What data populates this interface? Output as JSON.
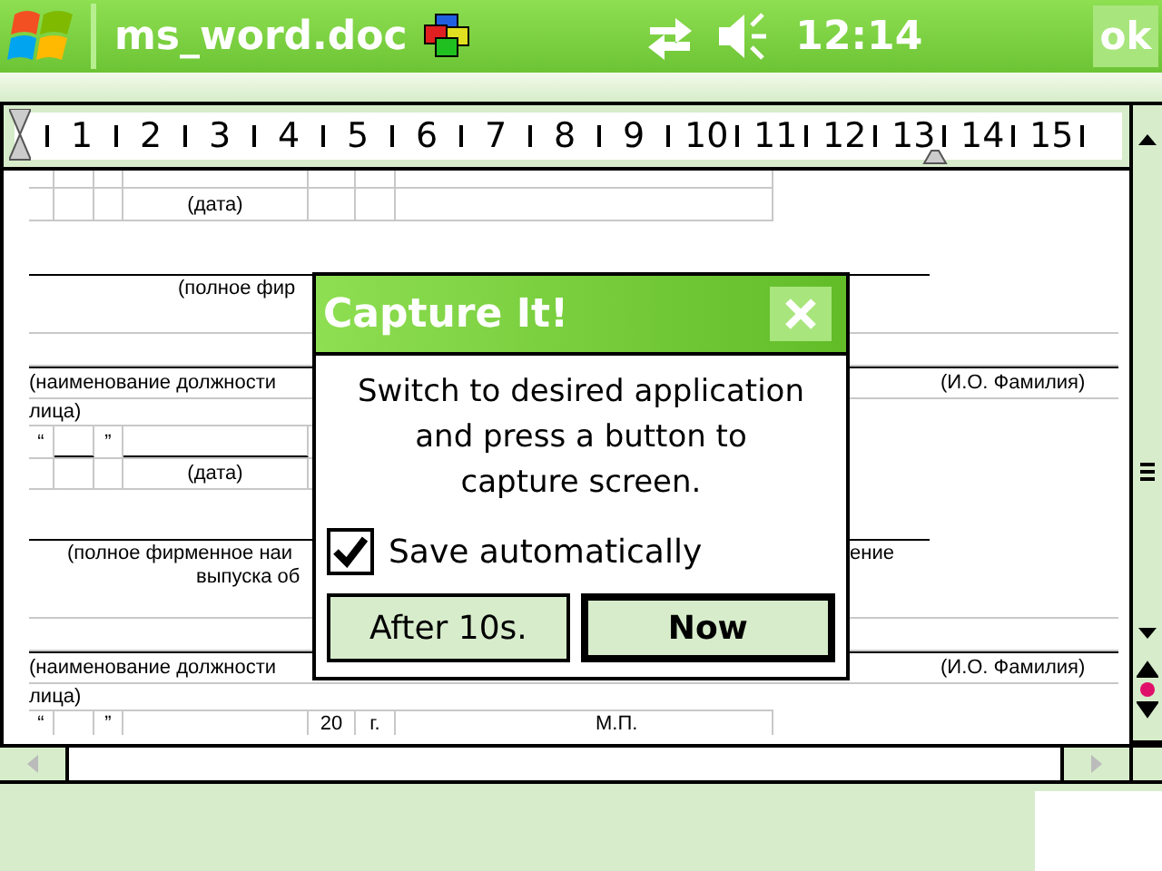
{
  "title_bar": {
    "title": "ms_word.doc",
    "time": "12:14",
    "ok_label": "ok"
  },
  "ruler": {
    "labels": [
      "1",
      "2",
      "3",
      "4",
      "5",
      "6",
      "7",
      "8",
      "9",
      "10",
      "11",
      "12",
      "13",
      "14",
      "15"
    ]
  },
  "document": [
    {
      "kind": "date",
      "caption": "(дата)"
    },
    {
      "kind": "org",
      "lines": [
        "(полное фир"
      ]
    },
    {
      "kind": "sign",
      "position": "(наименование должности",
      "tail": "лица)",
      "name": "(И.О. Фамилия)"
    },
    {
      "kind": "date_quotes",
      "open": "“",
      "close": "”",
      "caption": "(дата)"
    },
    {
      "kind": "org",
      "lines": [
        "(полное фирменное наи",
        "выпуска об"
      ],
      "right": "ение"
    },
    {
      "kind": "sign",
      "position": "(наименование должности",
      "tail": "лица)",
      "name": "(И.О. Фамилия)"
    },
    {
      "kind": "stamp",
      "open": "“",
      "close": "”",
      "year": "20",
      "suffix": "г.",
      "seal": "М.П."
    }
  ],
  "dialog": {
    "title": "Capture It!",
    "message": "Switch to desired application and press a button to capture screen.",
    "checkbox": {
      "label": "Save automatically",
      "checked": true
    },
    "buttons": [
      {
        "label": "After 10s.",
        "default": false
      },
      {
        "label": "Now",
        "default": true
      }
    ]
  }
}
